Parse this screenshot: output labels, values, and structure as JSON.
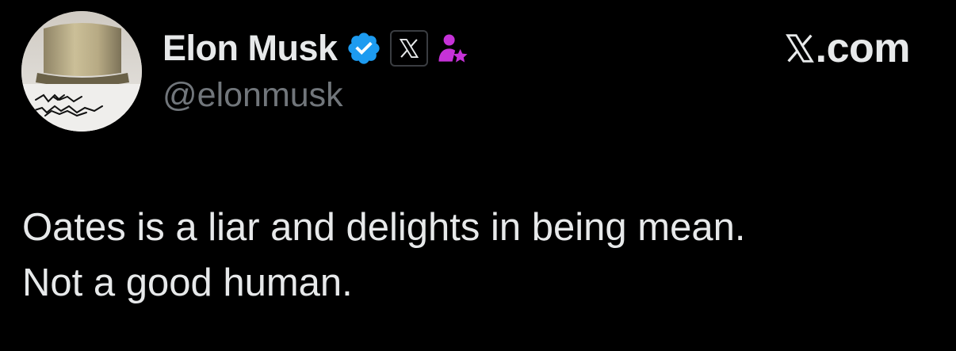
{
  "tweet": {
    "author": {
      "display_name": "Elon Musk",
      "handle": "@elonmusk",
      "avatar_icon": "avatar-image",
      "badges": [
        "verified-badge-icon",
        "x-affiliation-icon",
        "person-star-icon"
      ]
    },
    "brand": {
      "text": ".com",
      "icon": "x-logo-icon"
    },
    "text_lines": [
      "Oates is a liar and delights in being mean.",
      "Not a good human."
    ]
  },
  "colors": {
    "background": "#000000",
    "primary_text": "#e7e9ea",
    "secondary_text": "#71767b",
    "verified_blue": "#1d9bf0",
    "person_badge": "#c632d8"
  }
}
